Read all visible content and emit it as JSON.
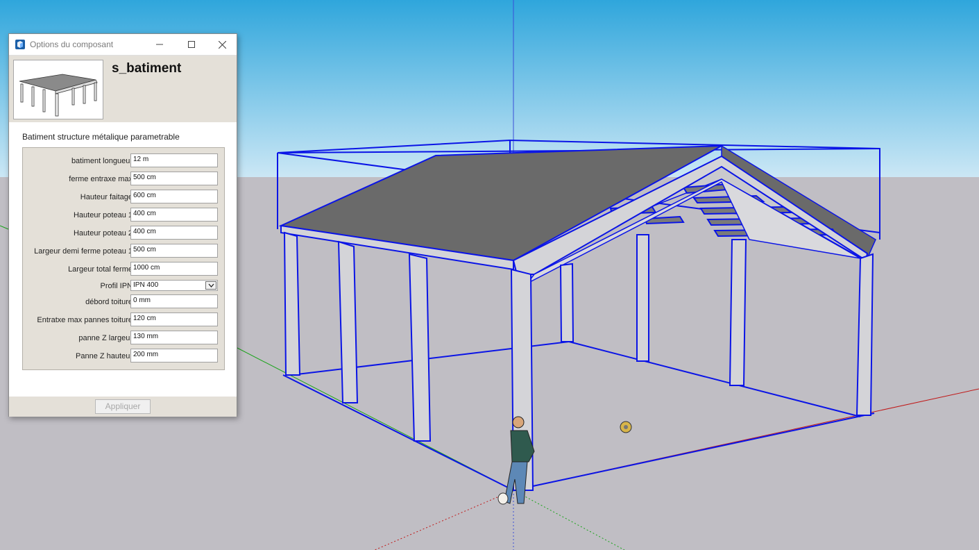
{
  "dialog": {
    "title": "Options du composant",
    "component_name": "s_batiment",
    "description": "Batiment structure métalique parametrable",
    "apply_label": "Appliquer",
    "params": [
      {
        "label": "batiment longueur",
        "value": "12 m",
        "type": "text"
      },
      {
        "label": "ferme entraxe max",
        "value": "500 cm",
        "type": "text"
      },
      {
        "label": "Hauteur faitage",
        "value": "600 cm",
        "type": "text"
      },
      {
        "label": "Hauteur poteau 1",
        "value": "400 cm",
        "type": "text"
      },
      {
        "label": "Hauteur poteau 2",
        "value": "400 cm",
        "type": "text"
      },
      {
        "label": "Largeur demi ferme poteau 1",
        "value": "500 cm",
        "type": "text"
      },
      {
        "label": "Largeur total ferme",
        "value": "1000 cm",
        "type": "text"
      },
      {
        "label": "Profil IPN",
        "value": "IPN 400",
        "type": "select"
      },
      {
        "label": "débord toiture",
        "value": "0 mm",
        "type": "text"
      },
      {
        "label": "Entratxe max pannes toiture",
        "value": "120 cm",
        "type": "text"
      },
      {
        "label": "panne Z largeur",
        "value": "130 mm",
        "type": "text"
      },
      {
        "label": "Panne Z hauteur",
        "value": "200 mm",
        "type": "text"
      }
    ]
  },
  "scene": {
    "sky_top": "#2fa6dc",
    "sky_bottom": "#c9e6f4",
    "ground": "#c0bec4",
    "selection": "#0a14e6",
    "roof": "#6a6a6a",
    "steel": "#d4d4d8"
  }
}
